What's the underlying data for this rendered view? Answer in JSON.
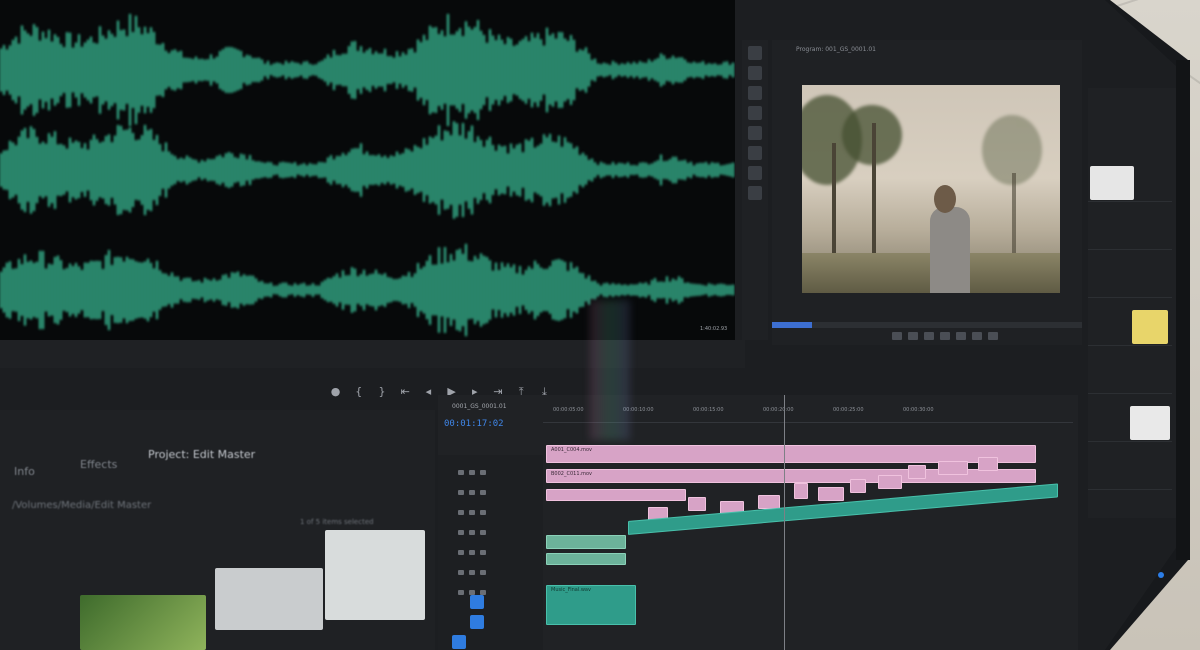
{
  "app": {
    "accent_color": "#2f7ce0",
    "waveform_color": "#3fd3a7"
  },
  "waveform": {
    "readout": "1:40:02.93"
  },
  "transport": {
    "icons": [
      "marker-icon",
      "in-point-icon",
      "out-point-icon",
      "go-to-in-icon",
      "step-back-icon",
      "play-icon",
      "step-forward-icon",
      "go-to-out-icon",
      "insert-icon",
      "overwrite-icon",
      "export-frame-icon"
    ]
  },
  "program_monitor": {
    "tab": "Program: 001_GS_0001.01"
  },
  "timeline": {
    "sequence_tab": "0001_GS_0001.01",
    "timecode": "00:01:17:02",
    "ruler_ticks": [
      "00:00:05:00",
      "00:00:10:00",
      "00:00:15:00",
      "00:00:20:00",
      "00:00:25:00",
      "00:00:30:00"
    ],
    "clips": {
      "video_1": "A001_C004.mov",
      "video_2": "B002_C011.mov",
      "audio_1": "Music_Final.wav"
    }
  },
  "project_panel": {
    "tabs": [
      "Info",
      "Effects",
      "Project: Edit Master"
    ],
    "path": "/Volumes/Media/Edit Master",
    "selection": "1 of 5 items selected"
  }
}
